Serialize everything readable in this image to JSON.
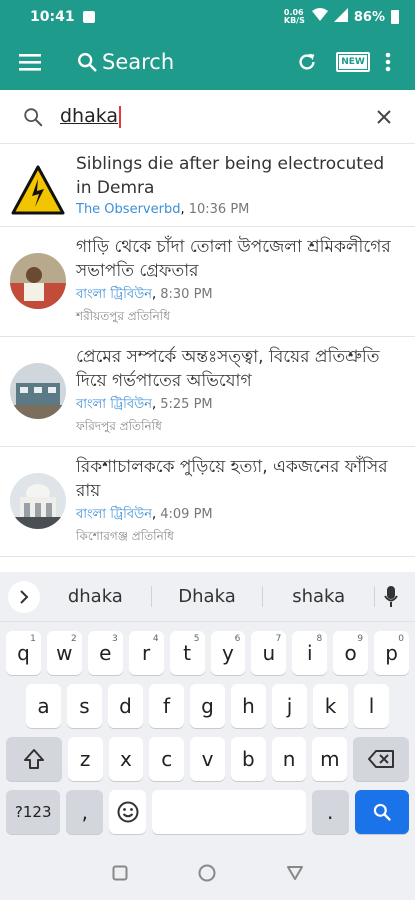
{
  "status": {
    "time": "10:41",
    "network": "0.06 KB/S",
    "battery": "86%"
  },
  "appbar": {
    "search_label": "Search",
    "new_badge": "NEW"
  },
  "search": {
    "query": "dhaka"
  },
  "news": [
    {
      "title": "Siblings die after being electrocuted in Demra",
      "source": "The Observerbd",
      "time": "10:36 PM",
      "sub": "",
      "thumb": "warning-sign"
    },
    {
      "title": "গাড়ি থেকে চাঁদা তোলা উপজেলা শ্রমিকলীগের সভাপতি গ্রেফতার",
      "source": "বাংলা ট্রিবিউন",
      "time": "8:30 PM",
      "sub": "শরীয়তপুর প্রতিনিধি",
      "thumb": "person-photo"
    },
    {
      "title": "প্রেমের সম্পর্কে অন্তঃসত্ত্বা, বিয়ের প্রতিশ্রুতি দিয়ে গর্ভপাতের অভিযোগ",
      "source": "বাংলা ট্রিবিউন",
      "time": "5:25 PM",
      "sub": "ফরিদপুর প্রতিনিধি",
      "thumb": "building-photo"
    },
    {
      "title": "রিকশাচালককে পুড়িয়ে হত্যা, একজনের ফাঁসির রায়",
      "source": "বাংলা ট্রিবিউন",
      "time": "4:09 PM",
      "sub": "কিশোরগঞ্জ প্রতিনিধি",
      "thumb": "court-photo"
    }
  ],
  "keyboard": {
    "suggestions": [
      "dhaka",
      "Dhaka",
      "shaka"
    ],
    "row1": [
      {
        "k": "q",
        "h": "1"
      },
      {
        "k": "w",
        "h": "2"
      },
      {
        "k": "e",
        "h": "3"
      },
      {
        "k": "r",
        "h": "4"
      },
      {
        "k": "t",
        "h": "5"
      },
      {
        "k": "y",
        "h": "6"
      },
      {
        "k": "u",
        "h": "7"
      },
      {
        "k": "i",
        "h": "8"
      },
      {
        "k": "o",
        "h": "9"
      },
      {
        "k": "p",
        "h": "0"
      }
    ],
    "row2": [
      "a",
      "s",
      "d",
      "f",
      "g",
      "h",
      "j",
      "k",
      "l"
    ],
    "row3": [
      "z",
      "x",
      "c",
      "v",
      "b",
      "n",
      "m"
    ],
    "sym_label": "?123",
    "comma": ",",
    "period": "."
  }
}
